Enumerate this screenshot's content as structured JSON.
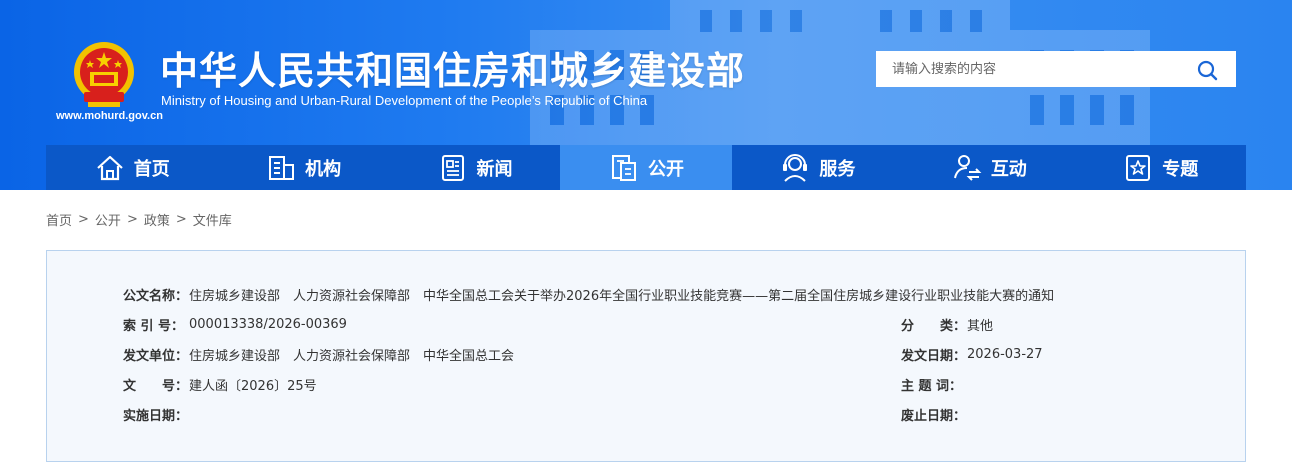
{
  "header": {
    "title_cn": "中华人民共和国住房和城乡建设部",
    "title_en": "Ministry of Housing and Urban-Rural Development of the People’s Republic of China",
    "site_url": "www.mohurd.gov.cn",
    "search_placeholder": "请输入搜索的内容"
  },
  "nav": {
    "items": [
      {
        "label": "首页",
        "icon": "home-icon"
      },
      {
        "label": "机构",
        "icon": "building-icon"
      },
      {
        "label": "新闻",
        "icon": "news-icon"
      },
      {
        "label": "公开",
        "icon": "document-icon",
        "active": true
      },
      {
        "label": "服务",
        "icon": "service-icon"
      },
      {
        "label": "互动",
        "icon": "interaction-icon"
      },
      {
        "label": "专题",
        "icon": "star-icon"
      }
    ]
  },
  "breadcrumb": {
    "items": [
      "首页",
      "公开",
      "政策",
      "文件库"
    ],
    "separator": ">"
  },
  "doc_info": {
    "name_label": "公文名称：",
    "name_value": "住房城乡建设部　人力资源社会保障部　中华全国总工会关于举办2026年全国行业职业技能竞赛——第二届全国住房城乡建设行业职业技能大赛的通知",
    "index_label": "索 引 号：",
    "index_value": "000013338/2026-00369",
    "category_label": "分　　类：",
    "category_value": "其他",
    "issuer_label": "发文单位：",
    "issuer_value": "住房城乡建设部　人力资源社会保障部　中华全国总工会",
    "date_label": "发文日期：",
    "date_value": "2026-03-27",
    "docno_label": "文　　号：",
    "docno_value": "建人函〔2026〕25号",
    "keywords_label": "主 题 词：",
    "keywords_value": "",
    "effective_label": "实施日期：",
    "effective_value": "",
    "expiry_label": "废止日期：",
    "expiry_value": ""
  },
  "colors": {
    "header_blue": "#1f7bf0",
    "nav_blue": "#0b58c8",
    "nav_active": "#3a8ef0",
    "info_bg": "#f4f8fd",
    "info_border": "#b8d2ee"
  }
}
